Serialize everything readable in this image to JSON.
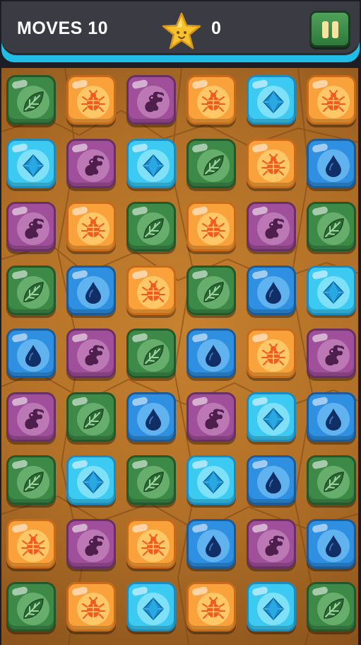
{
  "hud": {
    "moves_label": "MOVES 10",
    "score": "0",
    "star_icon": "star-icon",
    "pause_icon": "pause-icon"
  },
  "board": {
    "columns": 6,
    "rows": 9,
    "grid": [
      [
        "leaf",
        "bug",
        "dragon",
        "bug",
        "gem",
        "bug"
      ],
      [
        "gem",
        "dragon",
        "gem",
        "leaf",
        "bug",
        "drop"
      ],
      [
        "dragon",
        "bug",
        "leaf",
        "bug",
        "dragon",
        "leaf"
      ],
      [
        "leaf",
        "drop",
        "bug",
        "leaf",
        "drop",
        "gem"
      ],
      [
        "drop",
        "dragon",
        "leaf",
        "drop",
        "bug",
        "dragon"
      ],
      [
        "dragon",
        "leaf",
        "drop",
        "dragon",
        "gem",
        "drop"
      ],
      [
        "leaf",
        "gem",
        "leaf",
        "gem",
        "drop",
        "leaf"
      ],
      [
        "bug",
        "dragon",
        "bug",
        "drop",
        "dragon",
        "drop"
      ],
      [
        "leaf",
        "bug",
        "gem",
        "bug",
        "gem",
        "leaf"
      ]
    ]
  },
  "colors": {
    "leaf": "#3d8a48",
    "bug": "#f9a13a",
    "dragon": "#a0509a",
    "gem": "#3ccaf2",
    "drop": "#2f8fe0",
    "hud_accent": "#22bde6",
    "pause_button": "#3f9450"
  }
}
